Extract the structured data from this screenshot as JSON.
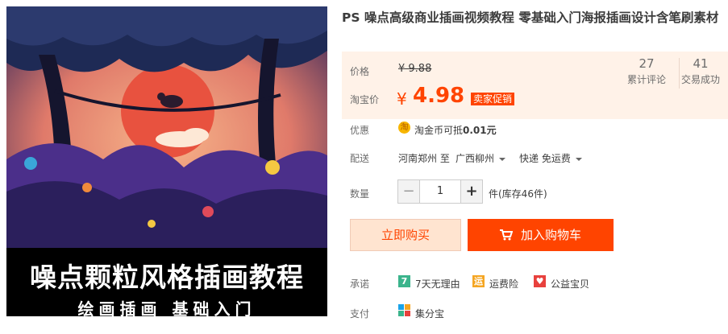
{
  "product": {
    "title": "PS 噪点高级商业插画视频教程 零基础入门海报插画设计含笔刷素材",
    "image_caption_main": "噪点颗粒风格插画教程",
    "image_caption_sub": "绘画插画  基础入门"
  },
  "price": {
    "original_label": "价格",
    "original_value": "¥ 9.88",
    "taobao_label": "淘宝价",
    "currency": "¥",
    "current_value": "4.98",
    "promo_tag": "卖家促销",
    "reviews_count": "27",
    "reviews_label": "累计评论",
    "sales_count": "41",
    "sales_label": "交易成功"
  },
  "promo": {
    "label": "优惠",
    "coin_icon_char": "淘",
    "text": "淘金币可抵",
    "amount": "0.01元"
  },
  "shipping": {
    "label": "配送",
    "from": "河南郑州 至",
    "to": "广西柳州",
    "method": "快递 免运费"
  },
  "quantity": {
    "label": "数量",
    "value": "1",
    "minus": "−",
    "plus": "+",
    "stock": "件(库存46件)"
  },
  "actions": {
    "buy_now": "立即购买",
    "add_to_cart": "加入购物车"
  },
  "promise": {
    "label": "承诺",
    "items": [
      {
        "icon_char": "7",
        "text": "7天无理由",
        "color": "#3bb48c"
      },
      {
        "icon_char": "运",
        "text": "运费险",
        "color": "#f5a623"
      },
      {
        "icon_char": "♥",
        "text": "公益宝贝",
        "color": "#e8413d"
      }
    ]
  },
  "payment": {
    "label": "支付",
    "text": "集分宝"
  },
  "colors": {
    "accent": "#ff4400",
    "price_bg": "#fff2e8",
    "buy_bg": "#ffe4d0"
  }
}
